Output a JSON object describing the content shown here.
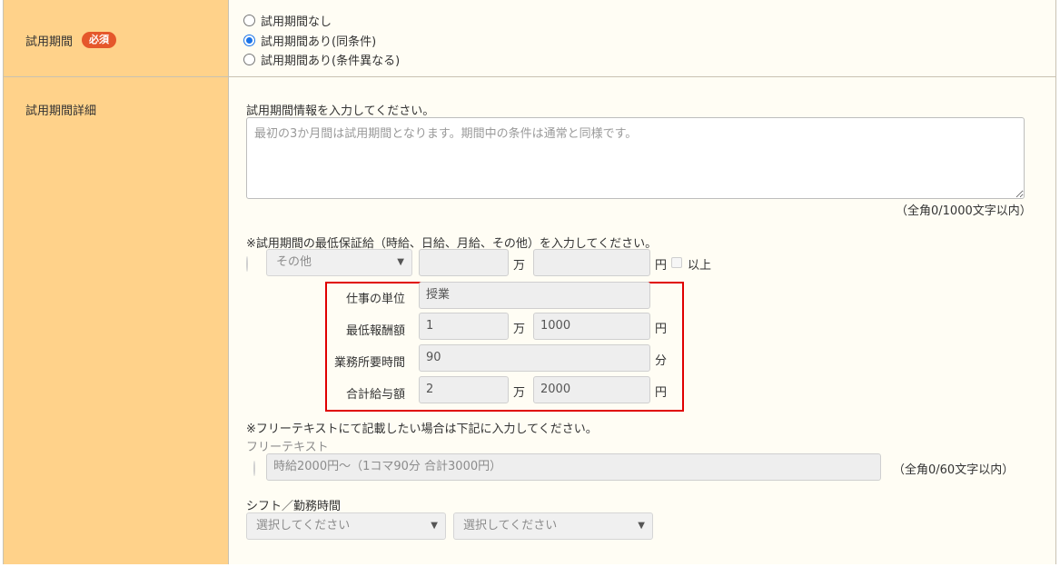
{
  "trial_period": {
    "label": "試用期間",
    "required_badge": "必須",
    "options": [
      {
        "label": "試用期間なし",
        "checked": false
      },
      {
        "label": "試用期間あり(同条件)",
        "checked": true
      },
      {
        "label": "試用期間あり(条件異なる)",
        "checked": false
      }
    ]
  },
  "trial_detail": {
    "label": "試用期間詳細",
    "info_prompt": "試用期間情報を入力してください。",
    "info_placeholder": "最初の3か月間は試用期間となります。期間中の条件は通常と同様です。",
    "info_counter": "（全角0/1000文字以内）",
    "min_pay_prompt": "※試用期間の最低保証給（時給、日給、月給、その他）を入力してください。",
    "pay_type_select": "その他",
    "man_unit": "万",
    "yen_unit": "円",
    "or_more_label": "以上",
    "breakdown": {
      "work_unit_label": "仕事の単位",
      "work_unit_value": "授業",
      "min_reward_label": "最低報酬額",
      "min_reward_man": "1",
      "min_reward_yen": "1000",
      "time_label": "業務所要時間",
      "time_value": "90",
      "time_unit": "分",
      "total_label": "合計給与額",
      "total_man": "2",
      "total_yen": "2000"
    },
    "free_text_prompt": "※フリーテキストにて記載したい場合は下記に入力してください。",
    "free_text_label": "フリーテキスト",
    "free_text_placeholder": "時給2000円〜（1コマ90分 合計3000円）",
    "free_text_counter": "（全角0/60文字以内）",
    "shift_label": "シフト／勤務時間",
    "shift_select_1": "選択してください",
    "shift_select_2": "選択してください"
  },
  "colors": {
    "header_bg": "#ffd28a",
    "cell_bg": "#fffdf4",
    "badge": "#e5572b",
    "highlight_border": "#e00000",
    "radio_accent": "#1a73e8"
  }
}
